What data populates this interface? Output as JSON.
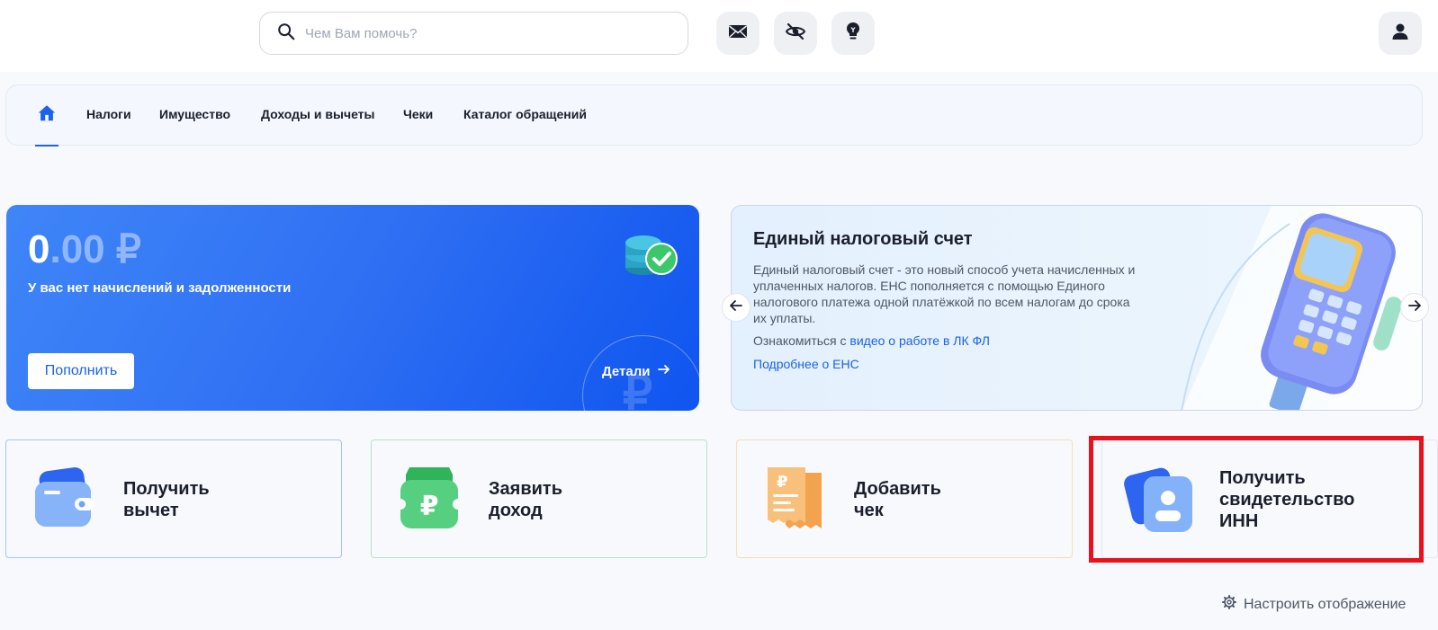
{
  "search": {
    "placeholder": "Чем Вам помочь?"
  },
  "header": {
    "icons": [
      "mail-icon",
      "eye-off-icon",
      "lightbulb-icon",
      "user-icon"
    ]
  },
  "nav": {
    "home_icon": "home-icon",
    "items": [
      "Налоги",
      "Имущество",
      "Доходы и вычеты",
      "Чеки",
      "Каталог обращений"
    ]
  },
  "balance": {
    "amount_int": "0",
    "amount_dec": ".00 ₽",
    "caption": "У вас нет начислений и задолженности",
    "topup_label": "Пополнить",
    "details_label": "Детали",
    "watermark": "₽"
  },
  "promo": {
    "title": "Единый налоговый счет",
    "description": "Единый налоговый счет - это новый способ учета начисленных и уплаченных налогов. ЕНС пополняется с помощью Единого налогового платежа одной платёжкой по всем налогам до срока их уплаты.",
    "link_prefix": "Ознакомиться с ",
    "link_text": "видео о работе в ЛК ФЛ",
    "more_text": "Подробнее о ЕНС"
  },
  "cards": [
    {
      "line1": "Получить",
      "line2": "вычет",
      "line3": ""
    },
    {
      "line1": "Заявить",
      "line2": "доход",
      "line3": ""
    },
    {
      "line1": "Добавить",
      "line2": "чек",
      "line3": ""
    },
    {
      "line1": "Получить",
      "line2": "свидетельство",
      "line3": "ИНН"
    }
  ],
  "settings": {
    "label": "Настроить отображение"
  },
  "colors": {
    "accent": "#1a62e8",
    "highlight": "#e8121c",
    "card1_border": "#a9c4f2",
    "card2_border": "#b8e3c4",
    "card3_border": "#f5dfb3"
  }
}
